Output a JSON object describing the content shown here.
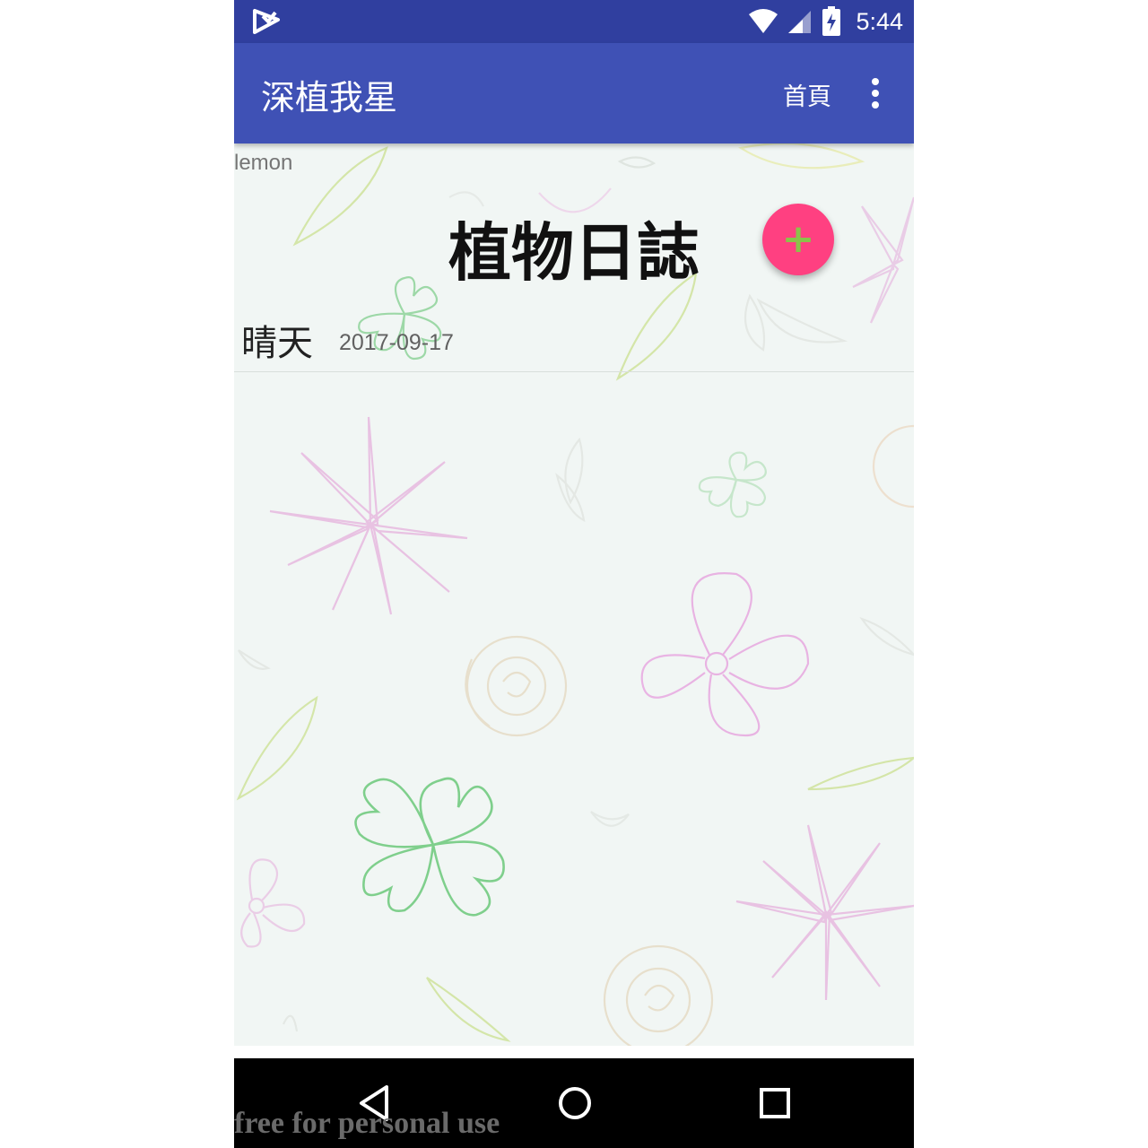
{
  "status_bar": {
    "time": "5:44",
    "icons": [
      "app-notification-icon",
      "wifi-icon",
      "signal-icon",
      "battery-charging-icon"
    ]
  },
  "app_bar": {
    "title": "深植我星",
    "home_action": "首頁",
    "menu_icon": "more-vert-icon"
  },
  "content": {
    "username": "lemon",
    "heading": "植物日誌",
    "fab_icon": "add-icon",
    "fab_symbol": "+",
    "entries": [
      {
        "weather": "晴天",
        "date": "2017-09-17"
      }
    ]
  },
  "nav_bar": {
    "buttons": [
      "back-icon",
      "home-icon",
      "recents-icon"
    ]
  },
  "watermark": "free for personal use",
  "colors": {
    "status_bar": "#303f9f",
    "app_bar": "#3f51b5",
    "fab": "#ff4081",
    "fab_icon": "#8bc34a",
    "nav_bar": "#000000"
  }
}
